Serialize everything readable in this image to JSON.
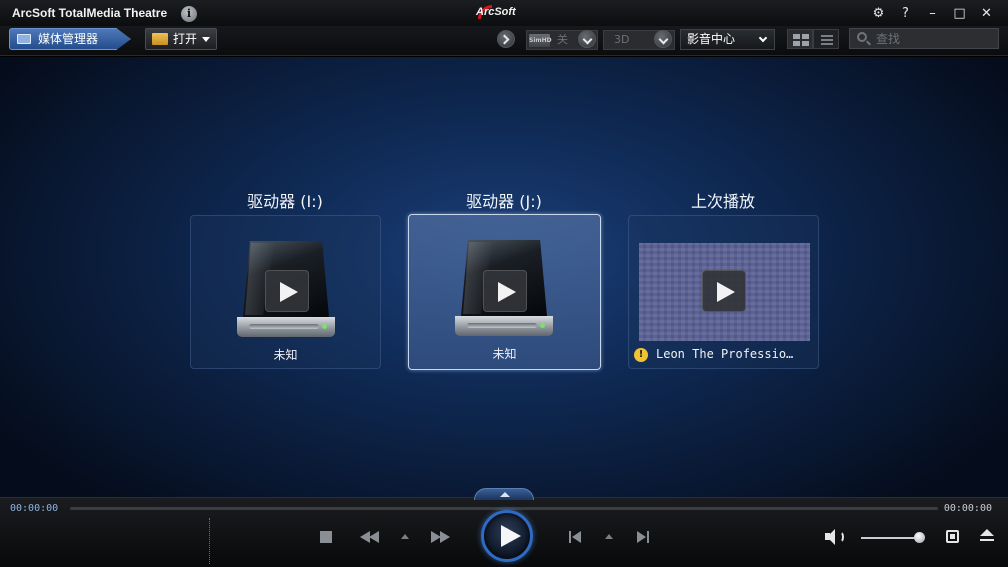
{
  "app": {
    "title": "ArcSoft TotalMedia Theatre",
    "brand": "ArcSoft",
    "info_icon": "i"
  },
  "window_controls": {
    "settings": "⚙",
    "help": "?",
    "minimize": "–",
    "maximize": "□",
    "close": "✕"
  },
  "toolbar": {
    "media_manager_label": "媒体管理器",
    "open_label": "打开",
    "simhd_badge": "SimHD",
    "simhd_value": "关",
    "mode_3d_value": "3D",
    "view_mode_selected": "影音中心",
    "search_placeholder": "查找"
  },
  "main": {
    "cards": [
      {
        "title": "驱动器 (I:)",
        "label": "未知",
        "type": "drive",
        "selected": false
      },
      {
        "title": "驱动器 (J:)",
        "label": "未知",
        "type": "drive",
        "selected": true
      },
      {
        "title": "上次播放",
        "label": "Leon The Professio…",
        "type": "last-played",
        "warning": "!"
      }
    ]
  },
  "playback": {
    "elapsed": "00:00:00",
    "total": "00:00:00",
    "volume_level": 1.0
  },
  "colors": {
    "accent": "#2f6bc4",
    "selected_nav": "#3a67a8",
    "warning": "#f1c232"
  }
}
